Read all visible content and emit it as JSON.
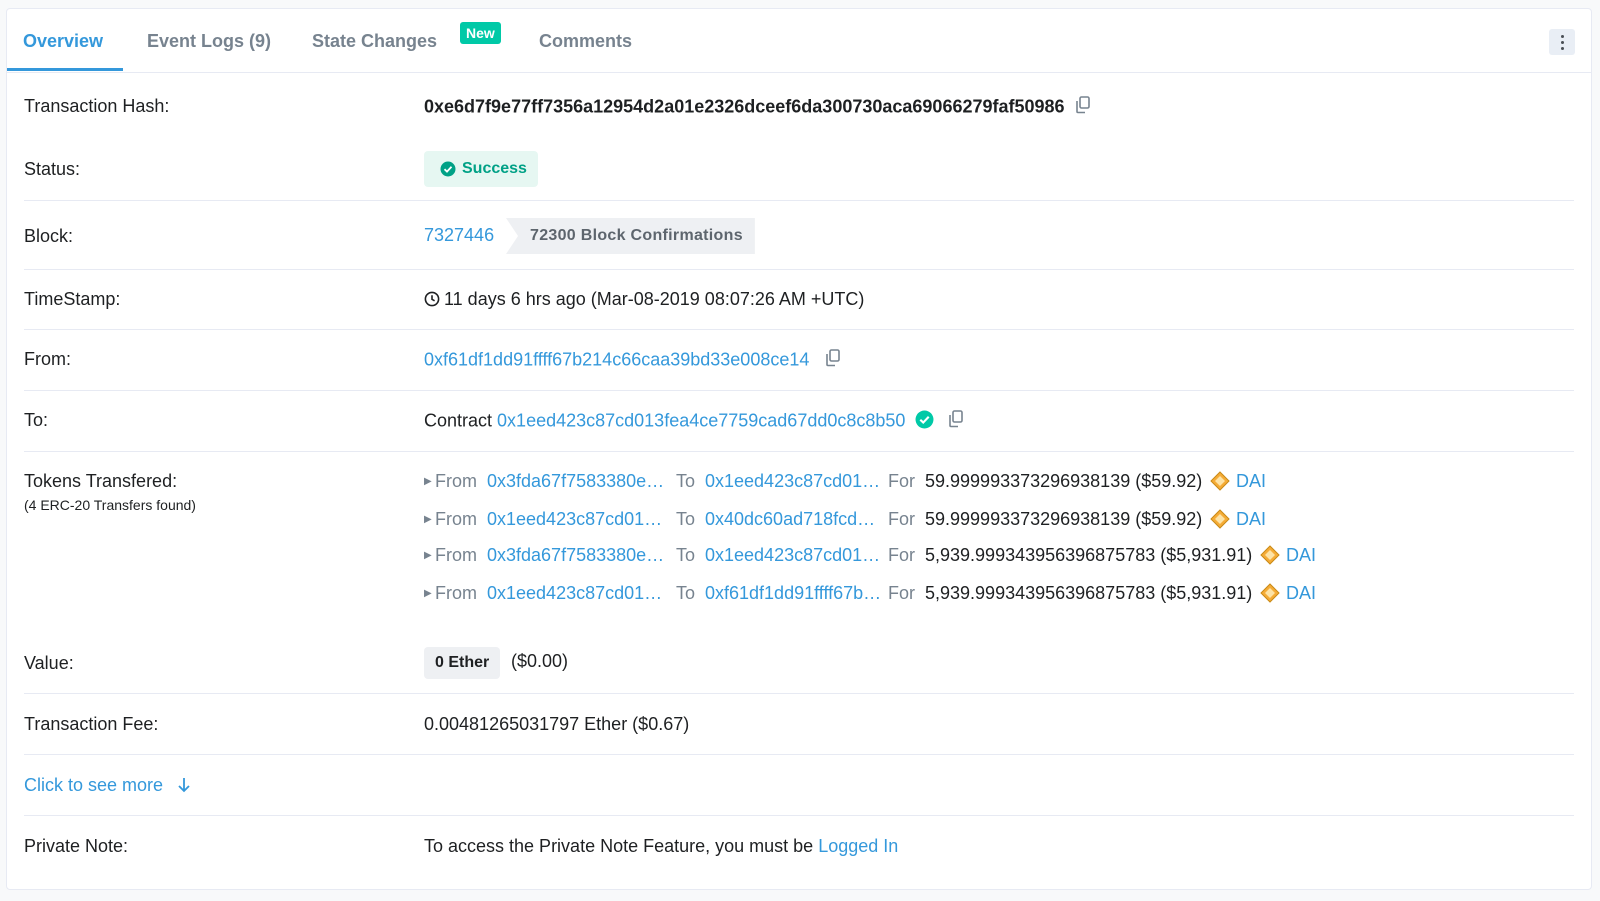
{
  "tabs": {
    "overview": "Overview",
    "event_logs": "Event Logs (9)",
    "state_changes": "State Changes",
    "new_badge": "New",
    "comments": "Comments"
  },
  "tx": {
    "hash_label": "Transaction Hash:",
    "hash": "0xe6d7f9e77ff7356a12954d2a01e2326dceef6da300730aca69066279faf50986",
    "status_label": "Status:",
    "status": "Success",
    "block_label": "Block:",
    "block": "7327446",
    "confirmations": "72300 Block Confirmations",
    "timestamp_label": "TimeStamp:",
    "timestamp": "11 days 6 hrs ago (Mar-08-2019 08:07:26 AM +UTC)",
    "from_label": "From:",
    "from": "0xf61df1dd91ffff67b214c66caa39bd33e008ce14",
    "to_label": "To:",
    "to_prefix": "Contract",
    "to": "0x1eed423c87cd013fea4ce7759cad67dd0c8c8b50",
    "tokens_label": "Tokens Transfered:",
    "tokens_sublabel": "(4 ERC-20 Transfers found)",
    "value_label": "Value:",
    "value": "0 Ether",
    "value_usd": "($0.00)",
    "fee_label": "Transaction Fee:",
    "fee": "0.00481265031797 Ether ($0.67)",
    "see_more": "Click to see more",
    "note_label": "Private Note:",
    "note_text": "To access the Private Note Feature, you must be",
    "note_link": "Logged In"
  },
  "transfers": [
    {
      "from_word": "From",
      "from": "0x3fda67f7583380e…",
      "to_word": "To",
      "to": "0x1eed423c87cd01…",
      "for_word": "For",
      "amount": "59.999993373296938139 ($59.92)",
      "token": "DAI"
    },
    {
      "from_word": "From",
      "from": "0x1eed423c87cd01…",
      "to_word": "To",
      "to": "0x40dc60ad718fcd…",
      "for_word": "For",
      "amount": "59.999993373296938139 ($59.92)",
      "token": "DAI"
    },
    {
      "from_word": "From",
      "from": "0x3fda67f7583380e…",
      "to_word": "To",
      "to": "0x1eed423c87cd01…",
      "for_word": "For",
      "amount": "5,939.999343956396875783 ($5,931.91)",
      "token": "DAI"
    },
    {
      "from_word": "From",
      "from": "0x1eed423c87cd01…",
      "to_word": "To",
      "to": "0xf61df1dd91ffff67b…",
      "for_word": "For",
      "amount": "5,939.999343956396875783 ($5,931.91)",
      "token": "DAI"
    }
  ],
  "colors": {
    "link": "#3498db",
    "success": "#00c9a7",
    "dai": "#f5ac37"
  }
}
